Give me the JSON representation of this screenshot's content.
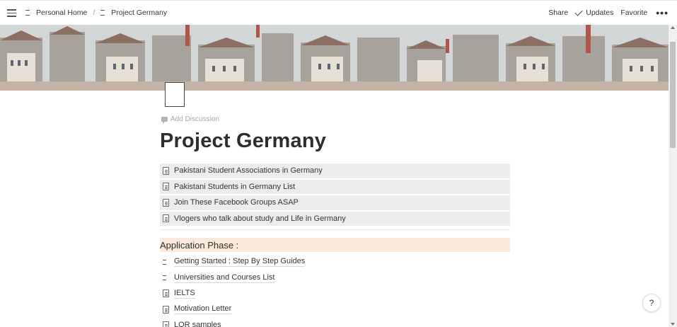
{
  "topbar": {
    "breadcrumbs": [
      {
        "label": "Personal Home"
      },
      {
        "label": "Project Germany"
      }
    ],
    "separator": "/",
    "share_label": "Share",
    "updates_label": "Updates",
    "favorite_label": "Favorite",
    "more_label": "•••"
  },
  "page": {
    "add_discussion": "Add Discussion",
    "title": "Project Germany"
  },
  "links": [
    {
      "label": "Pakistani Student Associations in Germany"
    },
    {
      "label": "Pakistani Students in Germany List"
    },
    {
      "label": "Join These Facebook Groups ASAP"
    },
    {
      "label": "Vlogers who talk about study and Life in Germany"
    }
  ],
  "section": {
    "heading": "Application Phase :",
    "heading_bg": "#fbeadb"
  },
  "sublist": [
    {
      "label": "Getting Started : Step By Step Guides",
      "icon": "page-icon"
    },
    {
      "label": "Universities and Courses List",
      "icon": "page-icon"
    },
    {
      "label": "IELTS",
      "icon": "document-icon"
    },
    {
      "label": "Motivation Letter",
      "icon": "document-icon"
    },
    {
      "label": "LOR samples",
      "icon": "document-icon"
    }
  ],
  "help": {
    "label": "?"
  }
}
